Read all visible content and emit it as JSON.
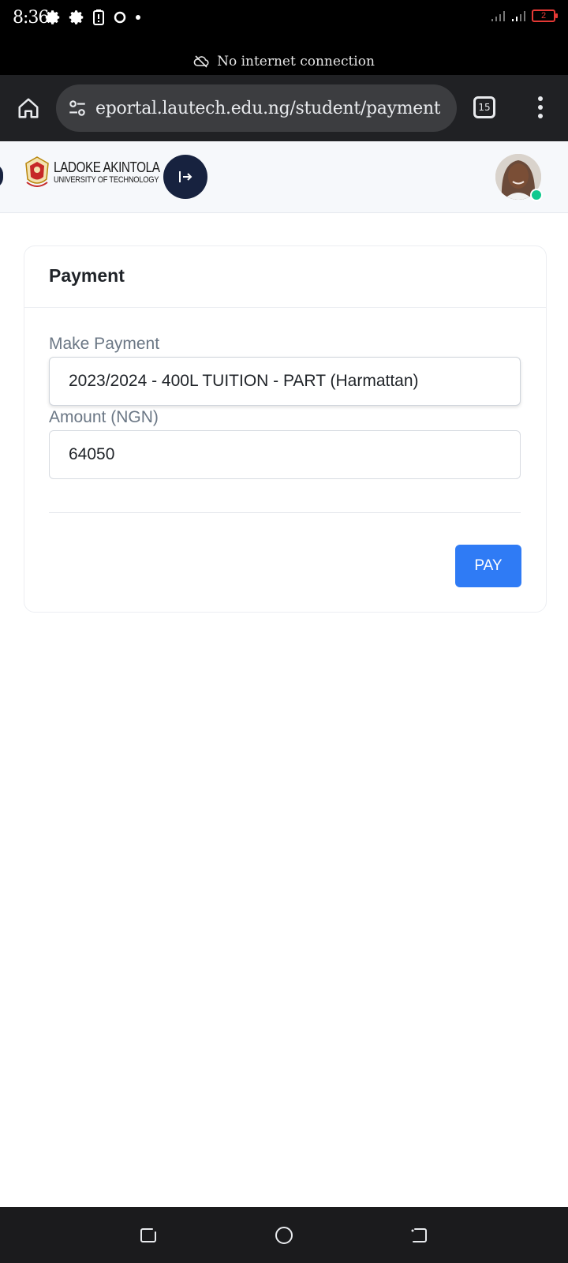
{
  "status_bar": {
    "time": "8:36",
    "battery_level": "2",
    "colors": {
      "background": "#000000",
      "battery": "#e53935"
    }
  },
  "offline_banner": {
    "text": "No internet connection"
  },
  "browser": {
    "url": "eportal.lautech.edu.ng/student/payment",
    "tab_count": "15"
  },
  "site_header": {
    "logo_line1": "LADOKE AKINTOLA",
    "logo_line2": "UNIVERSITY OF TECHNOLOGY",
    "colors": {
      "toggle_button": "#17223f",
      "online_dot": "#10c98f"
    }
  },
  "payment_card": {
    "title": "Payment",
    "make_payment_label": "Make Payment",
    "make_payment_value": "2023/2024 - 400L TUITION - PART (Harmattan)",
    "amount_label": "Amount (NGN)",
    "amount_value": "64050",
    "pay_button": "PAY",
    "colors": {
      "pay_button": "#2f7bf5"
    }
  },
  "nav_bar": {
    "items": [
      "recents-icon",
      "home-circle-icon",
      "back-icon"
    ]
  }
}
